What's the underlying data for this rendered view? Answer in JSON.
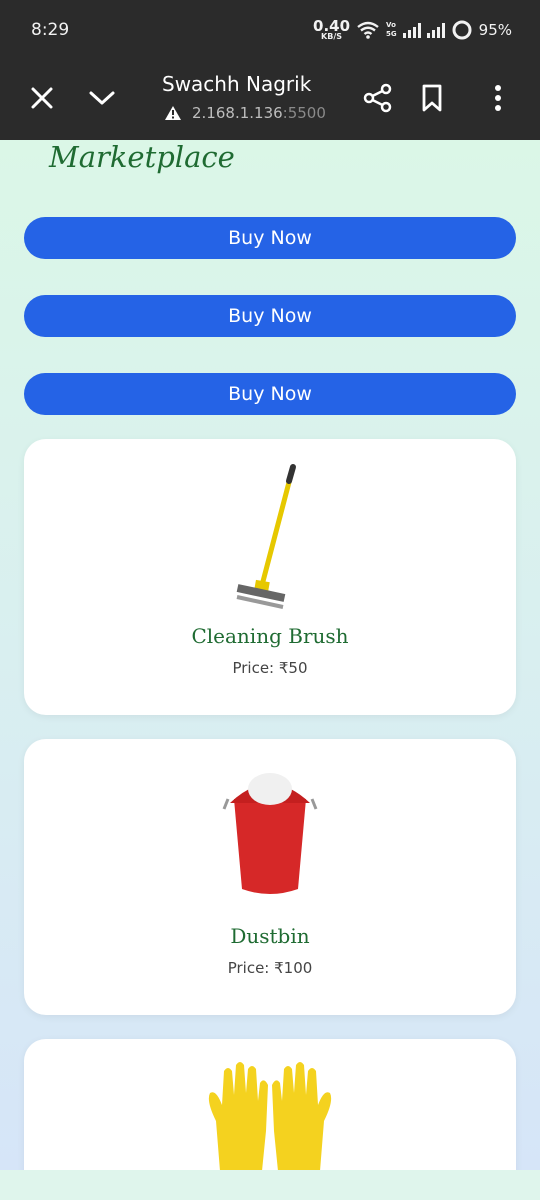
{
  "status_bar": {
    "time": "8:29",
    "speed_value": "0.40",
    "speed_unit": "KB/S",
    "volte_top": "Vo",
    "volte_bottom": "5G",
    "battery": "95%"
  },
  "browser": {
    "title": "Swachh Nagrik",
    "url_host": "2.168.1.136",
    "url_port": ":5500",
    "icons": [
      "close-icon",
      "chevron-down-icon",
      "warning-icon",
      "share-icon",
      "bookmark-icon",
      "more-vert-icon"
    ]
  },
  "page": {
    "heading": "Marketplace",
    "buy_buttons": [
      "Buy Now",
      "Buy Now",
      "Buy Now"
    ],
    "products": [
      {
        "name": "Cleaning Brush",
        "price": "Price: ₹50"
      },
      {
        "name": "Dustbin",
        "price": "Price: ₹100"
      },
      {
        "name": "",
        "price": ""
      }
    ]
  },
  "colors": {
    "button": "#2563e6",
    "heading": "#1f6b32",
    "toolbar": "#2b2b2b"
  }
}
